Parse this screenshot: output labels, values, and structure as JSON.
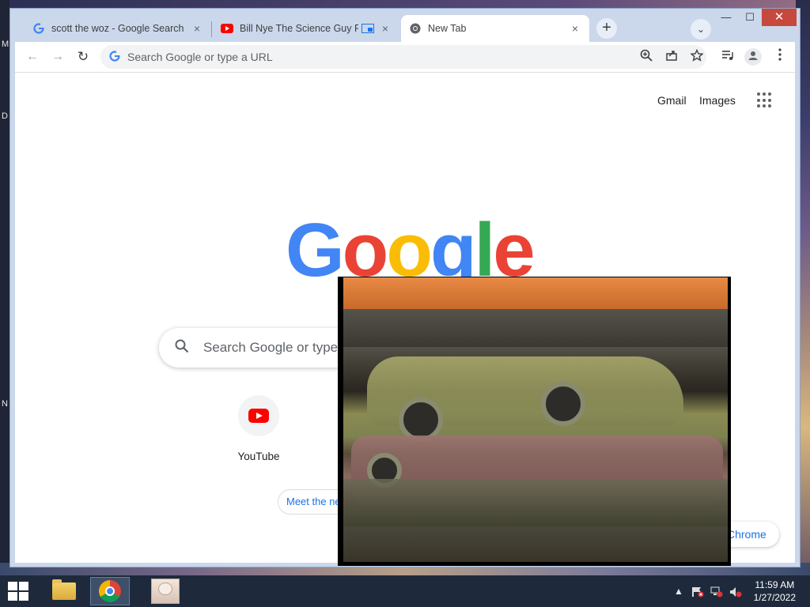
{
  "desktop": {
    "edge_letters": [
      "M",
      "D",
      "N"
    ]
  },
  "tabs": [
    {
      "title": "scott the woz - Google Search",
      "favicon": "google-favicon",
      "active": false
    },
    {
      "title": "Bill Nye The Science Guy Phs",
      "favicon": "youtube-favicon",
      "active": false
    },
    {
      "title": "New Tab",
      "favicon": "chrome-favicon",
      "active": true
    }
  ],
  "tab_icons": {
    "pip_indicator": "picture-in-picture-icon",
    "close": "×"
  },
  "titlebar": {
    "new_tab": "+",
    "tab_search": "⌄",
    "minimize": "—",
    "maximize": "☐",
    "close": "✕"
  },
  "toolbar": {
    "back": "←",
    "forward": "→",
    "reload": "↻",
    "omnibox_placeholder": "Search Google or type a URL",
    "icons": [
      "zoom-icon",
      "share-icon",
      "bookmark-star-icon",
      "media-controls-icon",
      "profile-icon",
      "more-menu-icon"
    ]
  },
  "ntp": {
    "gmail": "Gmail",
    "images": "Images",
    "logo_letters": [
      {
        "ch": "G",
        "color": "#4285f4"
      },
      {
        "ch": "o",
        "color": "#ea4335"
      },
      {
        "ch": "o",
        "color": "#fbbc05"
      },
      {
        "ch": "g",
        "color": "#4285f4"
      },
      {
        "ch": "l",
        "color": "#34a853"
      },
      {
        "ch": "e",
        "color": "#ea4335"
      }
    ],
    "search_placeholder": "Search Google or type",
    "shortcut_label": "YouTube",
    "meet_chip": "Meet the ne",
    "customize_chip": "Chrome"
  },
  "taskbar": {
    "apps": [
      "file-explorer-icon",
      "chrome-icon",
      "anime-app-icon"
    ],
    "tray_arrow": "▲",
    "time": "11:59 AM",
    "date": "1/27/2022"
  }
}
